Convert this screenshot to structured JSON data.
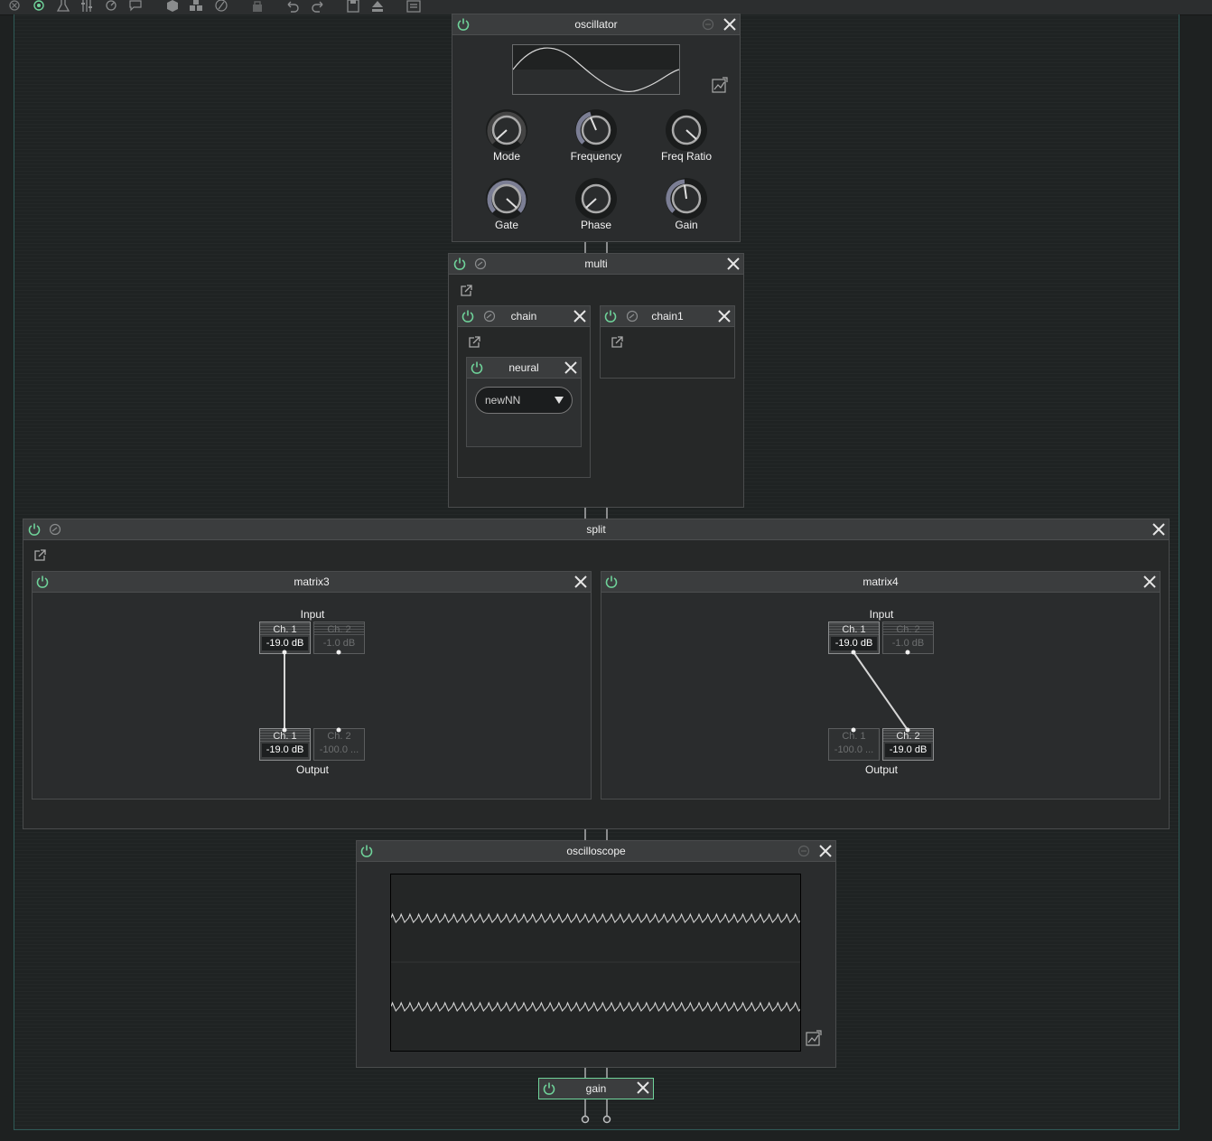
{
  "toolbar": {
    "icons": [
      "close-all-icon",
      "target-icon",
      "flask-icon",
      "sliders-icon",
      "gauge-icon",
      "comment-icon",
      "cube-icon",
      "cubes-icon",
      "percent-icon",
      "lock-icon",
      "undo-icon",
      "redo-icon",
      "save-icon",
      "eject-icon",
      "list-icon"
    ]
  },
  "oscillator": {
    "title": "oscillator",
    "knobs": {
      "mode": "Mode",
      "frequency": "Frequency",
      "freq_ratio": "Freq Ratio",
      "gate": "Gate",
      "phase": "Phase",
      "gain": "Gain"
    }
  },
  "multi": {
    "title": "multi"
  },
  "chain": {
    "title": "chain"
  },
  "chain1": {
    "title": "chain1"
  },
  "neural": {
    "title": "neural",
    "model_select": "newNN"
  },
  "split": {
    "title": "split"
  },
  "matrix3": {
    "title": "matrix3",
    "input_label": "Input",
    "output_label": "Output",
    "inputs": [
      {
        "ch": "Ch. 1",
        "db": "-19.0 dB"
      },
      {
        "ch": "Ch. 2",
        "db": "-1.0 dB"
      }
    ],
    "outputs": [
      {
        "ch": "Ch. 1",
        "db": "-19.0 dB"
      },
      {
        "ch": "Ch. 2",
        "db": "-100.0 ..."
      }
    ]
  },
  "matrix4": {
    "title": "matrix4",
    "input_label": "Input",
    "output_label": "Output",
    "inputs": [
      {
        "ch": "Ch. 1",
        "db": "-19.0 dB"
      },
      {
        "ch": "Ch. 2",
        "db": "-1.0 dB"
      }
    ],
    "outputs": [
      {
        "ch": "Ch. 1",
        "db": "-100.0 ..."
      },
      {
        "ch": "Ch. 2",
        "db": "-19.0 dB"
      }
    ]
  },
  "oscilloscope": {
    "title": "oscilloscope"
  },
  "gain": {
    "title": "gain"
  },
  "colors": {
    "accent_green": "#6fd39a",
    "canvas_border": "#2f5a57",
    "panel": "#2a2c2d",
    "header": "#3b3d3e"
  }
}
